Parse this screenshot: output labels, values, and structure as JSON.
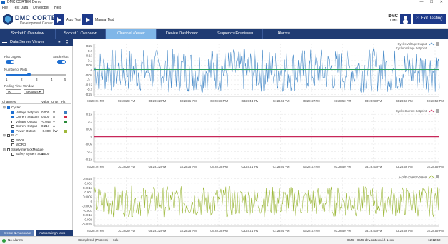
{
  "window": {
    "title": "DMC CORTEX Demo",
    "controls": "—  ☐  ✕"
  },
  "menu": [
    "File",
    "Test Data",
    "Developer",
    "Help"
  ],
  "brand": {
    "name": "DMC CORTEX",
    "tagline": "Development Center"
  },
  "toolbar": {
    "auto_test": "Auto Test",
    "manual_test": "Manual Test",
    "user_name": "DMC",
    "user_role": "DMC",
    "exit_label": "Exit Testing"
  },
  "tabs": [
    {
      "label": "Socket 0 Overview",
      "active": false
    },
    {
      "label": "Socket 1 Overview",
      "active": false
    },
    {
      "label": "Channel Viewer",
      "active": true
    },
    {
      "label": "Device Dashboard",
      "active": false
    },
    {
      "label": "Sequence Previewer",
      "active": false
    },
    {
      "label": "Alarms",
      "active": false
    }
  ],
  "sidebar": {
    "title": "Data Server Viewer",
    "controls": "⏸ ⛭",
    "plot_legend_label": "Plot Legend",
    "stack_plots_label": "Stack Plots",
    "num_plots_label": "Number of Plots",
    "num_plots_ticks": [
      "1",
      "2",
      "3",
      "4",
      "5"
    ],
    "rolling_window_label": "Rolling Time Window",
    "rolling_window_value": "00",
    "rolling_window_unit": "Seconds",
    "columns": {
      "channels": "Channels",
      "value": "Value",
      "units": "Units",
      "plot": "Plt"
    },
    "channel_rows": [
      {
        "name": "Cycler",
        "indent": 0,
        "value": "",
        "units": "",
        "checked": true,
        "color": ""
      },
      {
        "name": "Voltage Setpoint",
        "indent": 1,
        "value": "0.000",
        "units": "V",
        "checked": true,
        "color": "#3a7fc1"
      },
      {
        "name": "Current Setpoint",
        "indent": 1,
        "value": "0.000",
        "units": "A",
        "checked": true,
        "color": "#d02848"
      },
      {
        "name": "Voltage Output",
        "indent": 1,
        "value": "-0.045",
        "units": "V",
        "checked": false,
        "color": "#2a8a3a"
      },
      {
        "name": "Current Output",
        "indent": 1,
        "value": "0.217",
        "units": "A",
        "checked": false,
        "color": ""
      },
      {
        "name": "Power Output",
        "indent": 1,
        "value": "-0.000",
        "units": "kW",
        "checked": true,
        "color": "#9fb83a"
      },
      {
        "name": "PLC",
        "indent": 0,
        "value": "",
        "units": "",
        "checked": false,
        "color": ""
      },
      {
        "name": "BOOL",
        "indent": 1,
        "value": "",
        "units": "",
        "checked": false,
        "color": ""
      },
      {
        "name": "WORD",
        "indent": 1,
        "value": "",
        "units": "",
        "checked": false,
        "color": ""
      },
      {
        "name": "SafetyInterlockModule",
        "indent": 0,
        "value": "",
        "units": "",
        "checked": false,
        "color": ""
      },
      {
        "name": "Safety System State",
        "indent": 1,
        "value": "1.000",
        "units": "",
        "checked": false,
        "color": ""
      }
    ],
    "bottom_buttons": [
      "Create & Autoscale",
      "Autoscaling Y axis"
    ]
  },
  "plots": [
    {
      "legend": "Cycler.Voltage Output",
      "legend2": "Cycler.Voltage Setpoint",
      "color": "#4a8cc9",
      "color2": "#2aa05a",
      "ticks": [
        "0.25",
        "0.2",
        "0.15",
        "0.1",
        "0.05",
        "0",
        "-0.05",
        "-0.1",
        "-0.15",
        "-0.2",
        "-0.25"
      ],
      "ymin": -0.27,
      "ymax": 0.27,
      "amp": 0.23,
      "flat": false,
      "flat_val": 0
    },
    {
      "legend": "Cycler.Current Setpoint",
      "legend2": "",
      "color": "#c8285a",
      "color2": "",
      "ticks": [
        "0.15",
        "0.1",
        "0.05",
        "0",
        "-0.05",
        "-0.1",
        "-0.15"
      ],
      "ymin": -0.17,
      "ymax": 0.17,
      "amp": 0,
      "flat": true,
      "flat_val": 0
    },
    {
      "legend": "Cycler.Power Output",
      "legend2": "",
      "color": "#9cb83a",
      "color2": "",
      "ticks": [
        "0.0025",
        "0.002",
        "0.0015",
        "0.001",
        "0.0005",
        "0",
        "-0.0005",
        "-0.001",
        "-0.0015",
        "-0.002",
        "-0.0025"
      ],
      "ymin": -0.0027,
      "ymax": 0.0027,
      "amp": 0.0017,
      "flat": false,
      "flat_val": 0
    }
  ],
  "time_ticks": [
    "03:28:26 PM",
    "03:28:29 PM",
    "03:28:32 PM",
    "03:28:35 PM",
    "03:28:38 PM",
    "03:28:41 PM",
    "03:28:44 PM",
    "03:28:47 PM",
    "03:28:50 PM",
    "03:28:53 PM",
    "03:28:56 PM",
    "03:28:59 PM"
  ],
  "status": {
    "alarms": "No Alarms",
    "mode": "Completed (Process) — Idle",
    "user": "DMC",
    "center": "DMC dev.cortex.ui.h-1.xxx",
    "time": "12:12:52"
  }
}
